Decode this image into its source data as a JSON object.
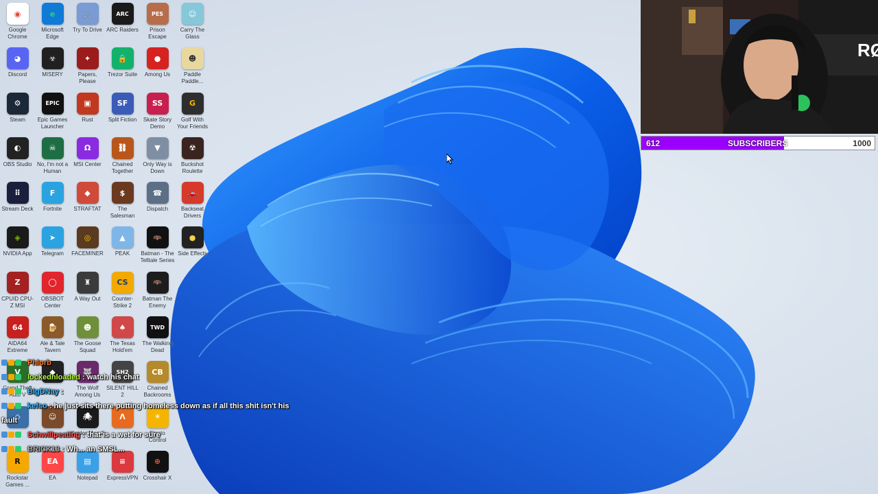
{
  "desktop": {
    "icons": [
      {
        "label": "Google Chrome",
        "icon": "chrome-icon",
        "color": "#ffffff",
        "fg": "#db4437",
        "glyph": "◉"
      },
      {
        "label": "Microsoft Edge",
        "icon": "edge-icon",
        "color": "#0f7bd6",
        "fg": "#2fd07a",
        "glyph": "e"
      },
      {
        "label": "Try To Drive",
        "icon": "game-icon",
        "color": "#7a9bd4",
        "fg": "#fff",
        "glyph": "🚲"
      },
      {
        "label": "ARC Raiders",
        "icon": "game-icon",
        "color": "#1a1a1a",
        "fg": "#fff",
        "glyph": "ARC"
      },
      {
        "label": "Prison Escape Simulator",
        "icon": "game-icon",
        "color": "#b86d4a",
        "fg": "#fff",
        "glyph": "PES"
      },
      {
        "label": "Carry The Glass",
        "icon": "game-icon",
        "color": "#86c7d9",
        "fg": "#fff",
        "glyph": "☺"
      },
      {
        "label": "Discord",
        "icon": "discord-icon",
        "color": "#5865f2",
        "fg": "#fff",
        "glyph": "◕"
      },
      {
        "label": "MISERY",
        "icon": "game-icon",
        "color": "#202020",
        "fg": "#eee",
        "glyph": "☣"
      },
      {
        "label": "Papers, Please",
        "icon": "game-icon",
        "color": "#9b1c1c",
        "fg": "#fff",
        "glyph": "✦"
      },
      {
        "label": "Trezor Suite",
        "icon": "trezor-icon",
        "color": "#13b26b",
        "fg": "#fff",
        "glyph": "🔒"
      },
      {
        "label": "Among Us",
        "icon": "game-icon",
        "color": "#d6231f",
        "fg": "#fff",
        "glyph": "●"
      },
      {
        "label": "Paddle Paddle...",
        "icon": "game-icon",
        "color": "#e8d8a0",
        "fg": "#333",
        "glyph": "☻"
      },
      {
        "label": "Steam",
        "icon": "steam-icon",
        "color": "#1b2838",
        "fg": "#fff",
        "glyph": "⚙"
      },
      {
        "label": "Epic Games Launcher",
        "icon": "epic-icon",
        "color": "#111111",
        "fg": "#fff",
        "glyph": "EPIC"
      },
      {
        "label": "Rust",
        "icon": "game-icon",
        "color": "#c2371f",
        "fg": "#fff",
        "glyph": "▣"
      },
      {
        "label": "Split Fiction",
        "icon": "game-icon",
        "color": "#3a5bb8",
        "fg": "#fff",
        "glyph": "SF"
      },
      {
        "label": "Skate Story Demo",
        "icon": "game-icon",
        "color": "#c8204e",
        "fg": "#fff",
        "glyph": "SS"
      },
      {
        "label": "Golf With Your Friends",
        "icon": "game-icon",
        "color": "#2e2e2e",
        "fg": "#f5b400",
        "glyph": "G"
      },
      {
        "label": "OBS Studio",
        "icon": "obs-icon",
        "color": "#222222",
        "fg": "#fff",
        "glyph": "◐"
      },
      {
        "label": "No, I'm not a Human",
        "icon": "game-icon",
        "color": "#1f6d44",
        "fg": "#fff",
        "glyph": "☠"
      },
      {
        "label": "MSI Center",
        "icon": "msi-icon",
        "color": "#8a2be2",
        "fg": "#fff",
        "glyph": "Ω"
      },
      {
        "label": "Chained Together",
        "icon": "game-icon",
        "color": "#b8561b",
        "fg": "#fff",
        "glyph": "⛓"
      },
      {
        "label": "Only Way is Down",
        "icon": "game-icon",
        "color": "#7f8fa3",
        "fg": "#fff",
        "glyph": "▼"
      },
      {
        "label": "Buckshot Roulette",
        "icon": "game-icon",
        "color": "#3a2420",
        "fg": "#fff",
        "glyph": "☢"
      },
      {
        "label": "Stream Deck",
        "icon": "streamdeck-icon",
        "color": "#1a1f3c",
        "fg": "#fff",
        "glyph": "⠿"
      },
      {
        "label": "Fortnite",
        "icon": "game-icon",
        "color": "#2aa3e0",
        "fg": "#fff",
        "glyph": "F"
      },
      {
        "label": "STRAFTAT",
        "icon": "game-icon",
        "color": "#d04a3a",
        "fg": "#fff",
        "glyph": "◆"
      },
      {
        "label": "The Salesman",
        "icon": "game-icon",
        "color": "#6b3a1e",
        "fg": "#fff",
        "glyph": "$"
      },
      {
        "label": "Dispatch",
        "icon": "game-icon",
        "color": "#5c6f86",
        "fg": "#fff",
        "glyph": "☎"
      },
      {
        "label": "Backseat Drivers",
        "icon": "game-icon",
        "color": "#d63a2a",
        "fg": "#fff",
        "glyph": "🚗"
      },
      {
        "label": "NVIDIA App",
        "icon": "nvidia-icon",
        "color": "#1a1a1a",
        "fg": "#76b900",
        "glyph": "◈"
      },
      {
        "label": "Telegram",
        "icon": "telegram-icon",
        "color": "#2aa3e0",
        "fg": "#fff",
        "glyph": "➤"
      },
      {
        "label": "FACEMINER",
        "icon": "game-icon",
        "color": "#5a3b1f",
        "fg": "#ffcc00",
        "glyph": "◎"
      },
      {
        "label": "PEAK",
        "icon": "game-icon",
        "color": "#7fb6e8",
        "fg": "#fff",
        "glyph": "▲"
      },
      {
        "label": "Batman - The Telltale Series",
        "icon": "game-icon",
        "color": "#111111",
        "fg": "#fff",
        "glyph": "🦇"
      },
      {
        "label": "Side Effects",
        "icon": "game-icon",
        "color": "#222222",
        "fg": "#f2d24a",
        "glyph": "●"
      },
      {
        "label": "CPUID CPU-Z MSI",
        "icon": "cpuz-icon",
        "color": "#a32121",
        "fg": "#fff",
        "glyph": "Z"
      },
      {
        "label": "OBSBOT Center",
        "icon": "obsbot-icon",
        "color": "#e0252d",
        "fg": "#fff",
        "glyph": "◯"
      },
      {
        "label": "A Way Out",
        "icon": "game-icon",
        "color": "#3b3b3b",
        "fg": "#fff",
        "glyph": "♜"
      },
      {
        "label": "Counter-Strike 2",
        "icon": "game-icon",
        "color": "#f2a900",
        "fg": "#1f3a6b",
        "glyph": "CS"
      },
      {
        "label": "Batman The Enemy",
        "icon": "game-icon",
        "color": "#1d1d1d",
        "fg": "#fff",
        "glyph": "🦇"
      },
      {
        "label": "",
        "icon": "empty",
        "color": "",
        "fg": "",
        "glyph": ""
      },
      {
        "label": "AIDA64 Extreme",
        "icon": "aida-icon",
        "color": "#c8201e",
        "fg": "#fff",
        "glyph": "64"
      },
      {
        "label": "Ale & Tale Tavern",
        "icon": "game-icon",
        "color": "#8a5a2a",
        "fg": "#fff",
        "glyph": "🍺"
      },
      {
        "label": "The Goose Squad",
        "icon": "game-icon",
        "color": "#6f8f3a",
        "fg": "#fff",
        "glyph": "☻"
      },
      {
        "label": "The Texas Hold'em",
        "icon": "game-icon",
        "color": "#d04848",
        "fg": "#fff",
        "glyph": "♠"
      },
      {
        "label": "The Walking Dead",
        "icon": "game-icon",
        "color": "#111111",
        "fg": "#fff",
        "glyph": "TWD"
      },
      {
        "label": "",
        "icon": "empty",
        "color": "",
        "fg": "",
        "glyph": ""
      },
      {
        "label": "Grand Theft Auto V",
        "icon": "gta-icon",
        "color": "#2b6e2b",
        "fg": "#fff",
        "glyph": "V"
      },
      {
        "label": "",
        "icon": "game-icon",
        "color": "#222222",
        "fg": "#fff",
        "glyph": "◆"
      },
      {
        "label": "The Wolf Among Us",
        "icon": "game-icon",
        "color": "#6a2a6a",
        "fg": "#fff",
        "glyph": "🐺"
      },
      {
        "label": "SILENT HILL 2",
        "icon": "game-icon",
        "color": "#444444",
        "fg": "#fff",
        "glyph": "SH2"
      },
      {
        "label": "Chained Backrooms",
        "icon": "game-icon",
        "color": "#b58a2a",
        "fg": "#fff",
        "glyph": "CB"
      },
      {
        "label": "",
        "icon": "empty",
        "color": "",
        "fg": "",
        "glyph": ""
      },
      {
        "label": "",
        "icon": "game-icon",
        "color": "#3a6fa8",
        "fg": "#fff",
        "glyph": "◇"
      },
      {
        "label": "",
        "icon": "game-icon",
        "color": "#7a4a2a",
        "fg": "#fff",
        "glyph": "☺"
      },
      {
        "label": "Spider-Man 2",
        "icon": "game-icon",
        "color": "#1a1a1a",
        "fg": "#fff",
        "glyph": "🕷"
      },
      {
        "label": "",
        "icon": "game-icon",
        "color": "#e86a1e",
        "fg": "#fff",
        "glyph": "Λ"
      },
      {
        "label": "Elgato Control",
        "icon": "elgato-icon",
        "color": "#f5b400",
        "fg": "#fff",
        "glyph": "☀"
      },
      {
        "label": "",
        "icon": "empty",
        "color": "",
        "fg": "",
        "glyph": ""
      },
      {
        "label": "Rockstar Games ...",
        "icon": "rockstar-icon",
        "color": "#f5a800",
        "fg": "#111",
        "glyph": "R"
      },
      {
        "label": "EA",
        "icon": "ea-icon",
        "color": "#ff4747",
        "fg": "#fff",
        "glyph": "EA"
      },
      {
        "label": "Notepad",
        "icon": "notepad-icon",
        "color": "#3aa0e8",
        "fg": "#fff",
        "glyph": "▤"
      },
      {
        "label": "ExpressVPN",
        "icon": "expressvpn-icon",
        "color": "#da3940",
        "fg": "#fff",
        "glyph": "≡"
      },
      {
        "label": "Crosshair X",
        "icon": "crosshair-icon",
        "color": "#111111",
        "fg": "#ff4a2a",
        "glyph": "⊕"
      },
      {
        "label": "",
        "icon": "empty",
        "color": "",
        "fg": "",
        "glyph": ""
      }
    ]
  },
  "webcam": {
    "overlay_text": "RØ"
  },
  "subscriber_goal": {
    "current": "612",
    "label": "SUBSCRIBERS",
    "goal": "1000",
    "progress_fraction": 0.612,
    "fill_color": "#9b00ff"
  },
  "chat": {
    "messages": [
      {
        "user": "Phlorb",
        "user_color": "#ff7a2a",
        "text": ""
      },
      {
        "user": "lockednloaded",
        "user_color": "#b9ff3a",
        "text": ": watch his chat"
      },
      {
        "user": "BigDNay",
        "user_color": "#3ab9ff",
        "text": ":"
      },
      {
        "user": "kefso",
        "user_color": "#3ab9ff",
        "text": ": he just sits there putting homeless down as if all this shit isn't his"
      },
      {
        "user": "",
        "user_color": "#ffffff",
        "text": "fault"
      },
      {
        "user": "Schwillpeating",
        "user_color": "#ff5a5a",
        "text": ": that is a wet for sure"
      },
      {
        "user": "BRICK13",
        "user_color": "#b0b0b0",
        "text": ": Wh... an SMSL..."
      }
    ]
  }
}
